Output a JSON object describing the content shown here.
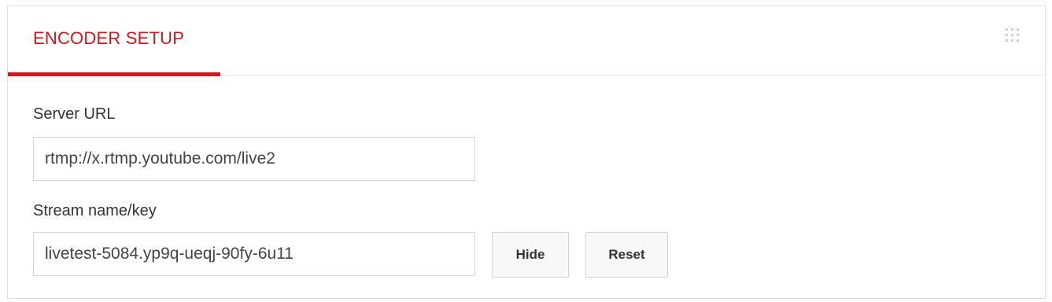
{
  "panel": {
    "tab_label": "ENCODER SETUP",
    "accent_color": "#cc181e",
    "drag_handle_icon": "grip-dots-icon"
  },
  "server": {
    "label": "Server URL",
    "value": "rtmp://x.rtmp.youtube.com/live2"
  },
  "stream": {
    "label": "Stream name/key",
    "value": "livetest-5084.yp9q-ueqj-90fy-6u11",
    "hide_label": "Hide",
    "reset_label": "Reset"
  }
}
